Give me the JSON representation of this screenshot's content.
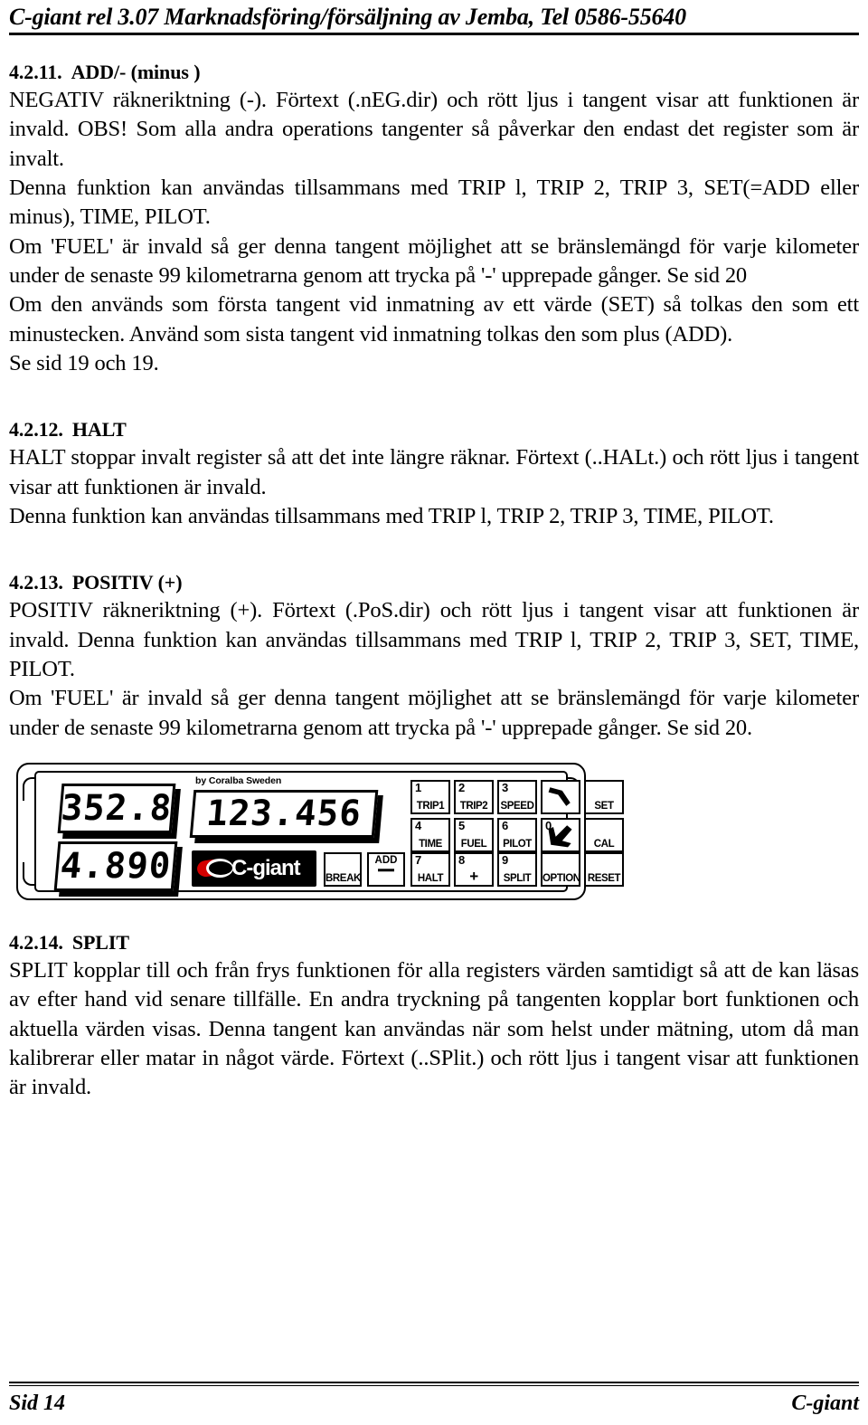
{
  "header": {
    "text": "C-giant rel 3.07 Marknadsföring/försäljning av Jemba,  Tel 0586-55640"
  },
  "sections": [
    {
      "number": "4.2.11.",
      "title": "ADD/- (minus )",
      "paragraphs": [
        "NEGATIV räkneriktning (-). Förtext (.nEG.dir) och rött ljus i tangent visar att funktionen är invald. OBS! Som alla andra operations tangenter så påverkar den endast det register som är invalt.",
        "Denna funktion kan användas tillsammans med TRIP l, TRIP 2, TRIP 3, SET(=ADD eller minus), TIME, PILOT.",
        "Om 'FUEL' är invald så ger denna tangent möjlighet att se bränslemängd för varje kilometer under de senaste 99 kilometrarna genom att trycka på '-' upprepade gånger. Se sid 20",
        "Om den används som första tangent vid inmatning av ett värde (SET) så tolkas den som ett minustecken. Använd som sista tangent vid inmatning tolkas den som plus (ADD).",
        "Se sid 19 och 19."
      ]
    },
    {
      "number": "4.2.12.",
      "title": "HALT",
      "paragraphs": [
        "HALT stoppar invalt register så att det inte längre räknar. Förtext (..HALt.) och rött ljus i tangent visar att funktionen är invald.",
        "Denna funktion kan användas tillsammans med TRIP l, TRIP 2, TRIP 3, TIME, PILOT."
      ]
    },
    {
      "number": "4.2.13.",
      "title": "POSITIV (+)",
      "paragraphs": [
        "POSITIV räkneriktning (+). Förtext (.PoS.dir) och rött ljus i tangent visar att funktionen är invald. Denna funktion kan användas tillsammans med TRIP l, TRIP 2, TRIP 3, SET, TIME, PILOT.",
        "Om 'FUEL' är invald så ger denna tangent möjlighet att se bränslemängd för varje kilometer under de senaste 99 kilometrarna genom att trycka på '-' upprepade gånger. Se sid 20."
      ]
    },
    {
      "number": "4.2.14.",
      "title": "SPLIT",
      "paragraphs": [
        "SPLIT kopplar till och från frys funktionen för alla registers värden samtidigt så att de kan läsas av efter hand vid senare tillfälle. En andra tryckning på tangenten kopplar bort funktionen och aktuella värden visas. Denna tangent kan användas när som helst under mätning, utom då man kalibrerar eller matar in något värde. Förtext (..SPlit.) och rött ljus i tangent visar att funktionen är invald."
      ]
    }
  ],
  "device": {
    "brand_line": "by Coralba Sweden",
    "logo_text": "C-giant",
    "logo_accent_color": "#d40000",
    "displays": {
      "upper_left": "352.8",
      "lower_left": "4.890",
      "main": "123.456"
    },
    "keys": {
      "break": "BREAK",
      "add_top": "ADD",
      "r1c1_num": "1",
      "r1c1_lbl": "TRIP1",
      "r1c2_num": "2",
      "r1c2_lbl": "TRIP2",
      "r1c3_num": "3",
      "r1c3_lbl": "SPEED",
      "r1c5_lbl": "SET",
      "r2c1_num": "4",
      "r2c1_lbl": "TIME",
      "r2c2_num": "5",
      "r2c2_lbl": "FUEL",
      "r2c3_num": "6",
      "r2c3_lbl": "PILOT",
      "r2c4_num": "0",
      "r2c5_lbl": "CAL",
      "r3c1_num": "7",
      "r3c1_lbl": "HALT",
      "r3c2_num": "8",
      "r3c2_lbl": "+",
      "r3c3_num": "9",
      "r3c3_lbl": "SPLIT",
      "r3c4_lbl": "OPTION",
      "r3c5_lbl": "RESET"
    }
  },
  "footer": {
    "left": "Sid 14",
    "right": "C-giant"
  }
}
